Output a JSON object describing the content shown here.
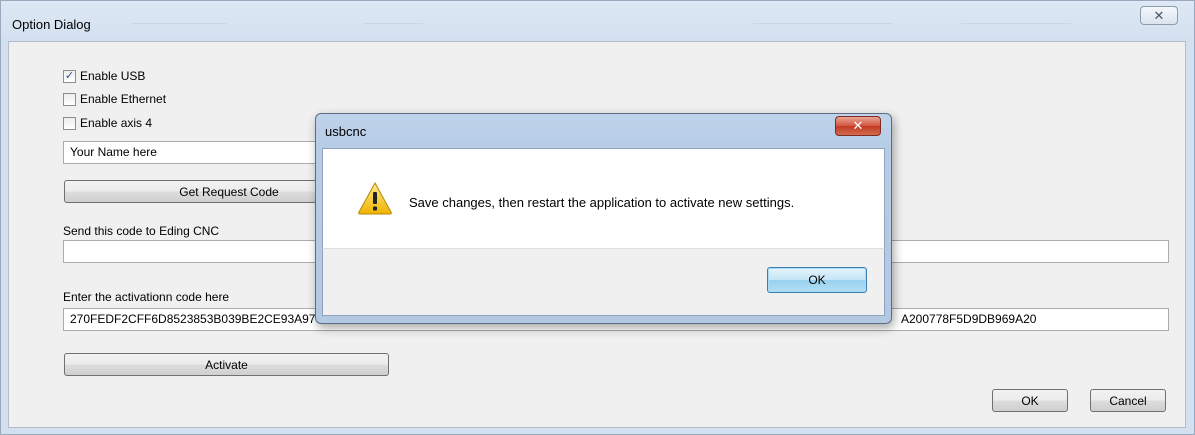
{
  "window": {
    "title": "Option Dialog",
    "close_glyph": "✕"
  },
  "options": {
    "enable_usb": {
      "label": "Enable USB",
      "checked": true
    },
    "enable_ethernet": {
      "label": "Enable Ethernet",
      "checked": false
    },
    "enable_axis4": {
      "label": "Enable axis 4",
      "checked": false
    },
    "name_value": "Your Name here",
    "get_request_label": "Get Request Code",
    "send_code_label": "Send this code to Eding CNC",
    "request_code_value": "",
    "activation_label": "Enter the activationn code here",
    "activation_code_left": "270FEDF2CFF6D8523853B039BE2CE93A97",
    "activation_code_right": "A200778F5D9DB969A20",
    "activate_label": "Activate",
    "ok_label": "OK",
    "cancel_label": "Cancel"
  },
  "modal": {
    "title": "usbcnc",
    "close_glyph": "✕",
    "icon": "warning-icon",
    "message": "Save changes, then restart the application to activate new settings.",
    "ok_label": "OK"
  },
  "colors": {
    "titlebar": "#d3e0ef",
    "client": "#f0f0f0",
    "modal_close": "#c13a24",
    "default_button": "#98d1ef",
    "warning": "#f4c430"
  }
}
